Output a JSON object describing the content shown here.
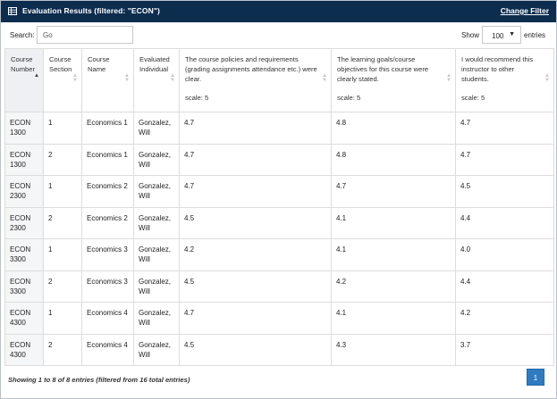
{
  "titlebar": {
    "icon": "table-icon",
    "title": "Evaluation Results (filtered: \"ECON\")",
    "change_filter": "Change Filter"
  },
  "toolbar": {
    "search_label": "Search:",
    "search_value": "Go",
    "show_label": "Show",
    "show_value": "100",
    "entries_label": "entries"
  },
  "columns": [
    {
      "label": "Course Number"
    },
    {
      "label": "Course Section"
    },
    {
      "label": "Course Name"
    },
    {
      "label": "Evaluated Individual"
    },
    {
      "label": "The course policies and requirements (grading assignments attendance etc.) were clear.",
      "scale": "scale: 5"
    },
    {
      "label": "The learning goals/course objectives for this course were clearly stated.",
      "scale": "scale: 5"
    },
    {
      "label": "I would recommend this instructor to other students.",
      "scale": "scale: 5"
    }
  ],
  "rows": [
    [
      "ECON 1300",
      "1",
      "Economics 1",
      "Gonzalez, Will",
      "4.7",
      "4.8",
      "4.7"
    ],
    [
      "ECON 1300",
      "2",
      "Economics 1",
      "Gonzalez, Will",
      "4.7",
      "4.8",
      "4.7"
    ],
    [
      "ECON 2300",
      "1",
      "Economics 2",
      "Gonzalez, Will",
      "4.7",
      "4.7",
      "4.5"
    ],
    [
      "ECON 2300",
      "2",
      "Economics 2",
      "Gonzalez, Will",
      "4.5",
      "4.1",
      "4.4"
    ],
    [
      "ECON 3300",
      "1",
      "Economics 3",
      "Gonzalez, Will",
      "4.2",
      "4.1",
      "4.0"
    ],
    [
      "ECON 3300",
      "2",
      "Economics 3",
      "Gonzalez, Will",
      "4.5",
      "4.2",
      "4.4"
    ],
    [
      "ECON 4300",
      "1",
      "Economics 4",
      "Gonzalez, Will",
      "4.7",
      "4.1",
      "4.2"
    ],
    [
      "ECON 4300",
      "2",
      "Economics 4",
      "Gonzalez, Will",
      "4.5",
      "4.3",
      "3.7"
    ]
  ],
  "footer": {
    "info": "Showing 1 to 8 of 8 entries (filtered from 16 total entries)",
    "page": "1"
  },
  "colors": {
    "titlebar_bg": "#0d2d4f",
    "pager_bg": "#2f7bc1"
  }
}
